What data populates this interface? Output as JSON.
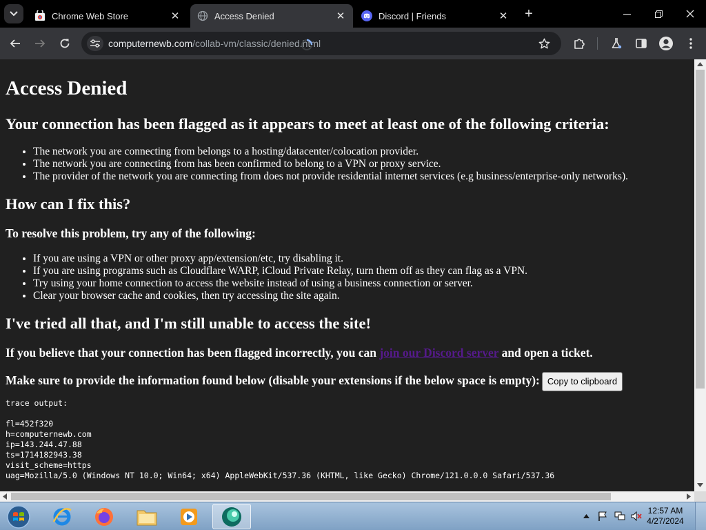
{
  "browser": {
    "tabs": [
      {
        "title": "Chrome Web Store",
        "active": false
      },
      {
        "title": "Access Denied",
        "active": true
      },
      {
        "title": "Discord | Friends",
        "active": false
      }
    ],
    "url": {
      "domain": "computernewb.com",
      "path": "/collab-vm/classic/denied.html"
    }
  },
  "page": {
    "h1": "Access Denied",
    "h2_criteria": "Your connection has been flagged as it appears to meet at least one of the following criteria:",
    "criteria": [
      "The network you are connecting from belongs to a hosting/datacenter/colocation provider.",
      "The network you are connecting from has been confirmed to belong to a VPN or proxy service.",
      "The provider of the network you are connecting from does not provide residential internet services (e.g business/enterprise-only networks)."
    ],
    "h2_fix": "How can I fix this?",
    "h3_resolve": "To resolve this problem, try any of the following:",
    "fixes": [
      "If you are using a VPN or other proxy app/extension/etc, try disabling it.",
      "If you are using programs such as Cloudflare WARP, iCloud Private Relay, turn them off as they can flag as a VPN.",
      "Try using your home connection to access the website instead of using a business connection or server.",
      "Clear your browser cache and cookies, then try accessing the site again."
    ],
    "h2_tried": "I've tried all that, and I'm still unable to access the site!",
    "believe_before": "If you believe that your connection has been flagged incorrectly, you can ",
    "discord_link": "join our Discord server",
    "believe_after": " and open a ticket.",
    "provide_text": "Make sure to provide the information found below (disable your extensions if the below space is empty):",
    "copy_button": "Copy to clipboard",
    "trace_label": "trace output:",
    "trace_lines": [
      "fl=452f320",
      "h=computernewb.com",
      "ip=143.244.47.88",
      "ts=1714182943.38",
      "visit_scheme=https",
      "uag=Mozilla/5.0 (Windows NT 10.0; Win64; x64) AppleWebKit/537.36 (KHTML, like Gecko) Chrome/121.0.0.0 Safari/537.36"
    ]
  },
  "taskbar": {
    "time": "12:57 AM",
    "date": "4/27/2024"
  }
}
